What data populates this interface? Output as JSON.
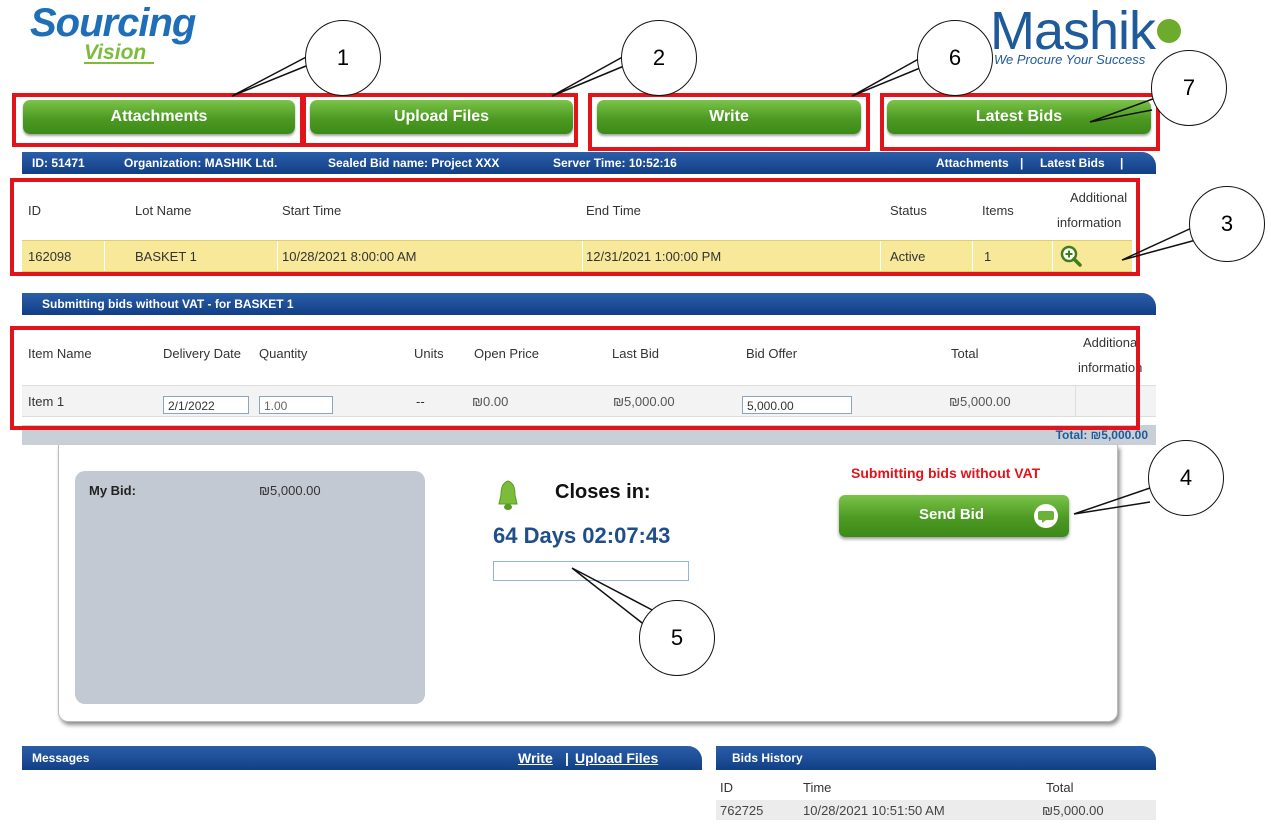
{
  "logo": {
    "left_line1": "Sourcing",
    "left_line2": "Vision",
    "right_name": "Mashik",
    "right_tagline": "We Procure Your Success"
  },
  "buttons": {
    "attachments": "Attachments",
    "upload_files": "Upload Files",
    "write": "Write",
    "latest_bids": "Latest Bids"
  },
  "info_bar": {
    "id": "ID: 51471",
    "organization": "Organization: MASHIK Ltd.",
    "bid_name": "Sealed Bid name: Project XXX",
    "server_time": "Server Time: 10:52:16",
    "link_attachments": "Attachments",
    "link_latest_bids": "Latest Bids",
    "sep": "|"
  },
  "lots": {
    "headers": {
      "id": "ID",
      "lot_name": "Lot Name",
      "start": "Start Time",
      "end": "End Time",
      "status": "Status",
      "items": "Items",
      "add1": "Additional",
      "add2": "information"
    },
    "row": {
      "id": "162098",
      "lot_name": "BASKET 1",
      "start": "10/28/2021 8:00:00 AM",
      "end": "12/31/2021 1:00:00 PM",
      "status": "Active",
      "items": "1"
    }
  },
  "bids_bar": {
    "title": "Submitting bids without VAT - for BASKET 1"
  },
  "items": {
    "headers": {
      "name": "Item Name",
      "delivery": "Delivery Date",
      "qty": "Quantity",
      "units": "Units",
      "open_price": "Open Price",
      "last_bid": "Last Bid",
      "bid_offer": "Bid Offer",
      "total": "Total",
      "add1": "Additional",
      "add2": "information"
    },
    "row": {
      "name": "Item 1",
      "delivery": "2/1/2022",
      "qty": "1.00",
      "units": "--",
      "open_price": "₪0.00",
      "last_bid": "₪5,000.00",
      "bid_offer": "5,000.00",
      "total": "₪5,000.00"
    },
    "total_line": "Total:  ₪5,000.00"
  },
  "panel": {
    "my_bid_label": "My Bid:",
    "my_bid_value": "₪5,000.00",
    "closes_label": "Closes in:",
    "countdown": "64 Days 02:07:43",
    "vat_note": "Submitting bids without VAT",
    "send_bid": "Send Bid"
  },
  "messages": {
    "title": "Messages",
    "write": "Write",
    "sep": "|",
    "upload": "Upload Files"
  },
  "history": {
    "title": "Bids History",
    "headers": {
      "id": "ID",
      "time": "Time",
      "total": "Total"
    },
    "row": {
      "id": "762725",
      "time": "10/28/2021 10:51:50 AM",
      "total": "₪5,000.00"
    }
  },
  "callouts": [
    "1",
    "2",
    "6",
    "7",
    "3",
    "4",
    "5"
  ],
  "colors": {
    "accent_green": "#4c9a22",
    "header_blue": "#123f86",
    "highlight": "#e0141a",
    "row_yellow": "#f7e89a"
  }
}
